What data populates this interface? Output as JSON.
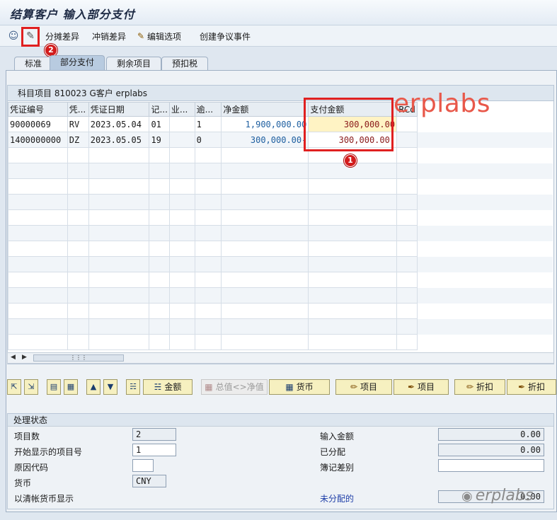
{
  "window": {
    "title": "结算客户 输入部分支付"
  },
  "toolbar": {
    "overview_icon": "person-icon",
    "edit_icon": "edit-pencil-icon",
    "distribute_diff": "分摊差异",
    "writeoff_diff": "冲销差异",
    "edit_options": "编辑选项",
    "create_dispute": "创建争议事件"
  },
  "markers": {
    "one": "1",
    "two": "2"
  },
  "tabs": [
    "标准",
    "部分支付",
    "剩余项目",
    "预扣税"
  ],
  "grid": {
    "caption": "科目项目 810023 G客户 erplabs",
    "columns": [
      "凭证编号",
      "凭...",
      "凭证日期",
      "记...",
      "业...",
      "逾...",
      "净金额",
      "支付金额",
      "RCd"
    ],
    "rows": [
      [
        "90000069",
        "RV",
        "2023.05.04",
        "01",
        "",
        "1",
        "1,900,000.00",
        "300,000.00",
        ""
      ],
      [
        "1400000000",
        "DZ",
        "2023.05.05",
        "19",
        "",
        "0",
        "300,000.00-",
        "300,000.00-",
        ""
      ]
    ]
  },
  "buttons": {
    "amount": "金额",
    "gross_net": "总值<>净值",
    "currency": "货币",
    "item1": "项目",
    "item2": "项目",
    "discount1": "折扣",
    "discount2": "折扣"
  },
  "status": {
    "header": "处理状态",
    "item_count_label": "项目数",
    "item_count": "2",
    "first_item_label": "开始显示的项目号",
    "first_item": "1",
    "reason_label": "原因代码",
    "reason": "",
    "currency_label": "货币",
    "currency": "CNY",
    "clearing_display_label": "以清帐货币显示",
    "entered_amount_label": "输入金额",
    "entered_amount": "0.00",
    "assigned_label": "已分配",
    "assigned": "0.00",
    "posting_diff_label": "簿记差别",
    "posting_diff": "",
    "unassigned_label": "未分配的",
    "unassigned": "0.00"
  },
  "watermarks": {
    "top": "erplabs",
    "bottom": "erplabs"
  }
}
